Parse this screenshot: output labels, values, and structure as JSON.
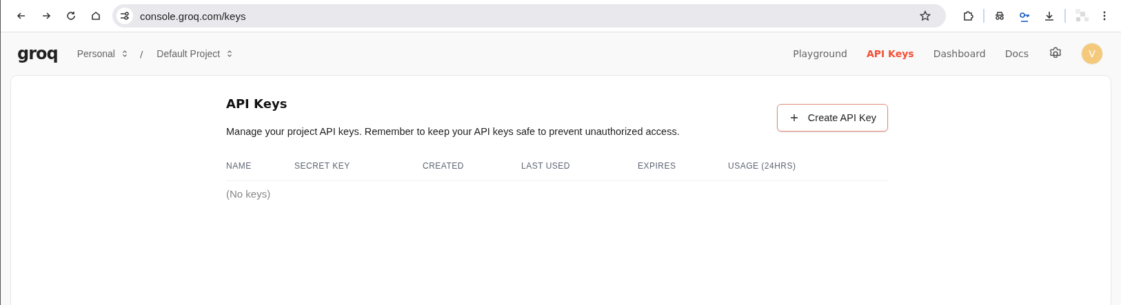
{
  "browser": {
    "url": "console.groq.com/keys"
  },
  "header": {
    "logo": "groq",
    "breadcrumbs": [
      {
        "label": "Personal"
      },
      {
        "label": "Default Project"
      }
    ],
    "separator": "/",
    "nav": [
      {
        "label": "Playground",
        "selected": false
      },
      {
        "label": "API Keys",
        "selected": true
      },
      {
        "label": "Dashboard",
        "selected": false
      },
      {
        "label": "Docs",
        "selected": false
      }
    ],
    "avatar": "V"
  },
  "page": {
    "title": "API Keys",
    "description": "Manage your project API keys. Remember to keep your API keys safe to prevent unauthorized access.",
    "create_button": "Create API Key",
    "table": {
      "columns": [
        "NAME",
        "SECRET KEY",
        "CREATED",
        "LAST USED",
        "EXPIRES",
        "USAGE (24HRS)"
      ],
      "empty": "(No keys)"
    }
  }
}
